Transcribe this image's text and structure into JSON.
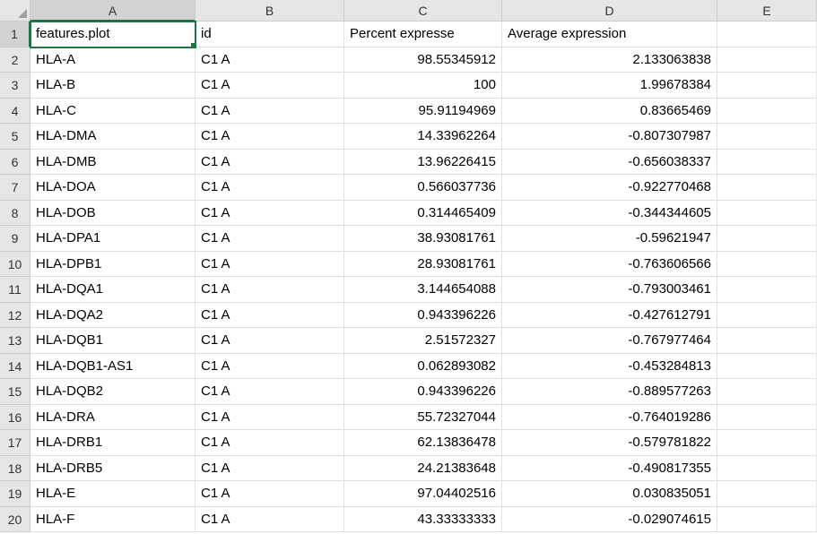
{
  "columns": [
    "A",
    "B",
    "C",
    "D",
    "E"
  ],
  "headerRow": {
    "A": "features.plot",
    "B": "id",
    "C": "Percent expresse",
    "D": "Average expression"
  },
  "activeCell": "A1",
  "selectedCol": "A",
  "selectedRow": 1,
  "rows": [
    {
      "n": 2,
      "A": "HLA-A",
      "B": "C1 A",
      "C": "98.55345912",
      "D": "2.133063838"
    },
    {
      "n": 3,
      "A": "HLA-B",
      "B": "C1 A",
      "C": "100",
      "D": "1.99678384"
    },
    {
      "n": 4,
      "A": "HLA-C",
      "B": "C1 A",
      "C": "95.91194969",
      "D": "0.83665469"
    },
    {
      "n": 5,
      "A": "HLA-DMA",
      "B": "C1 A",
      "C": "14.33962264",
      "D": "-0.807307987"
    },
    {
      "n": 6,
      "A": "HLA-DMB",
      "B": "C1 A",
      "C": "13.96226415",
      "D": "-0.656038337"
    },
    {
      "n": 7,
      "A": "HLA-DOA",
      "B": "C1 A",
      "C": "0.566037736",
      "D": "-0.922770468"
    },
    {
      "n": 8,
      "A": "HLA-DOB",
      "B": "C1 A",
      "C": "0.314465409",
      "D": "-0.344344605"
    },
    {
      "n": 9,
      "A": "HLA-DPA1",
      "B": "C1 A",
      "C": "38.93081761",
      "D": "-0.59621947"
    },
    {
      "n": 10,
      "A": "HLA-DPB1",
      "B": "C1 A",
      "C": "28.93081761",
      "D": "-0.763606566"
    },
    {
      "n": 11,
      "A": "HLA-DQA1",
      "B": "C1 A",
      "C": "3.144654088",
      "D": "-0.793003461"
    },
    {
      "n": 12,
      "A": "HLA-DQA2",
      "B": "C1 A",
      "C": "0.943396226",
      "D": "-0.427612791"
    },
    {
      "n": 13,
      "A": "HLA-DQB1",
      "B": "C1 A",
      "C": "2.51572327",
      "D": "-0.767977464"
    },
    {
      "n": 14,
      "A": "HLA-DQB1-AS1",
      "B": "C1 A",
      "C": "0.062893082",
      "D": "-0.453284813"
    },
    {
      "n": 15,
      "A": "HLA-DQB2",
      "B": "C1 A",
      "C": "0.943396226",
      "D": "-0.889577263"
    },
    {
      "n": 16,
      "A": "HLA-DRA",
      "B": "C1 A",
      "C": "55.72327044",
      "D": "-0.764019286"
    },
    {
      "n": 17,
      "A": "HLA-DRB1",
      "B": "C1 A",
      "C": "62.13836478",
      "D": "-0.579781822"
    },
    {
      "n": 18,
      "A": "HLA-DRB5",
      "B": "C1 A",
      "C": "24.21383648",
      "D": "-0.490817355"
    },
    {
      "n": 19,
      "A": "HLA-E",
      "B": "C1 A",
      "C": "97.04402516",
      "D": "0.030835051"
    },
    {
      "n": 20,
      "A": "HLA-F",
      "B": "C1 A",
      "C": "43.33333333",
      "D": "-0.029074615"
    }
  ],
  "chart_data": {
    "type": "table",
    "title": "",
    "columns": [
      "features.plot",
      "id",
      "Percent expressed",
      "Average expression"
    ],
    "data": [
      [
        "HLA-A",
        "C1 A",
        98.55345912,
        2.133063838
      ],
      [
        "HLA-B",
        "C1 A",
        100,
        1.99678384
      ],
      [
        "HLA-C",
        "C1 A",
        95.91194969,
        0.83665469
      ],
      [
        "HLA-DMA",
        "C1 A",
        14.33962264,
        -0.807307987
      ],
      [
        "HLA-DMB",
        "C1 A",
        13.96226415,
        -0.656038337
      ],
      [
        "HLA-DOA",
        "C1 A",
        0.566037736,
        -0.922770468
      ],
      [
        "HLA-DOB",
        "C1 A",
        0.314465409,
        -0.344344605
      ],
      [
        "HLA-DPA1",
        "C1 A",
        38.93081761,
        -0.59621947
      ],
      [
        "HLA-DPB1",
        "C1 A",
        28.93081761,
        -0.763606566
      ],
      [
        "HLA-DQA1",
        "C1 A",
        3.144654088,
        -0.793003461
      ],
      [
        "HLA-DQA2",
        "C1 A",
        0.943396226,
        -0.427612791
      ],
      [
        "HLA-DQB1",
        "C1 A",
        2.51572327,
        -0.767977464
      ],
      [
        "HLA-DQB1-AS1",
        "C1 A",
        0.062893082,
        -0.453284813
      ],
      [
        "HLA-DQB2",
        "C1 A",
        0.943396226,
        -0.889577263
      ],
      [
        "HLA-DRA",
        "C1 A",
        55.72327044,
        -0.764019286
      ],
      [
        "HLA-DRB1",
        "C1 A",
        62.13836478,
        -0.579781822
      ],
      [
        "HLA-DRB5",
        "C1 A",
        24.21383648,
        -0.490817355
      ],
      [
        "HLA-E",
        "C1 A",
        97.04402516,
        0.030835051
      ],
      [
        "HLA-F",
        "C1 A",
        43.33333333,
        -0.029074615
      ]
    ]
  }
}
